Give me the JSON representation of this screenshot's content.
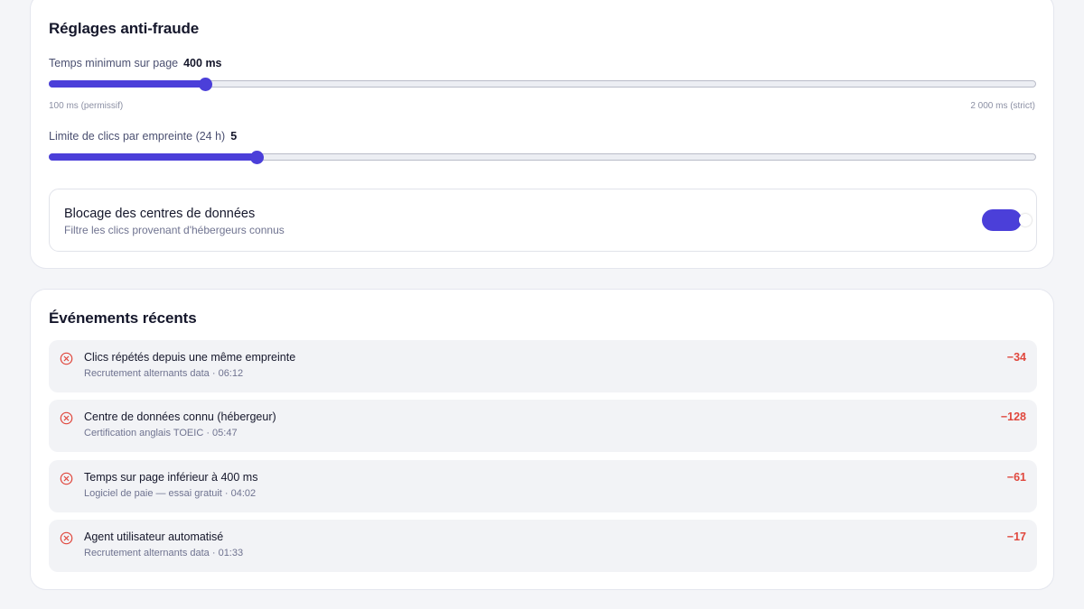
{
  "antifraud": {
    "title": "Réglages anti-fraude",
    "min_time": {
      "label": "Temps minimum sur page",
      "value_text": "400 ms",
      "value": 400,
      "min": 100,
      "max": 2000,
      "min_hint": "100 ms (permissif)",
      "max_hint": "2 000 ms (strict)"
    },
    "click_limit": {
      "label": "Limite de clics par empreinte (24 h)",
      "value_text": "5",
      "value": 5,
      "min": 1,
      "max": 20
    },
    "datacenter_block": {
      "title": "Blocage des centres de données",
      "subtitle": "Filtre les clics provenant d'hébergeurs connus",
      "enabled": true
    }
  },
  "events": {
    "title": "Événements récents",
    "items": [
      {
        "icon": "x-circle-icon",
        "title": "Clics répétés depuis une même empreinte",
        "meta": "Recrutement alternants data · 06:12",
        "score": "−34"
      },
      {
        "icon": "x-circle-icon",
        "title": "Centre de données connu (hébergeur)",
        "meta": "Certification anglais TOEIC · 05:47",
        "score": "−128"
      },
      {
        "icon": "x-circle-icon",
        "title": "Temps sur page inférieur à 400 ms",
        "meta": "Logiciel de paie — essai gratuit · 04:02",
        "score": "−61"
      },
      {
        "icon": "x-circle-icon",
        "title": "Agent utilisateur automatisé",
        "meta": "Recrutement alternants data · 01:33",
        "score": "−17"
      }
    ]
  },
  "colors": {
    "accent": "#4b3fd9",
    "danger": "#e0473d",
    "background": "#f4f5f8"
  }
}
